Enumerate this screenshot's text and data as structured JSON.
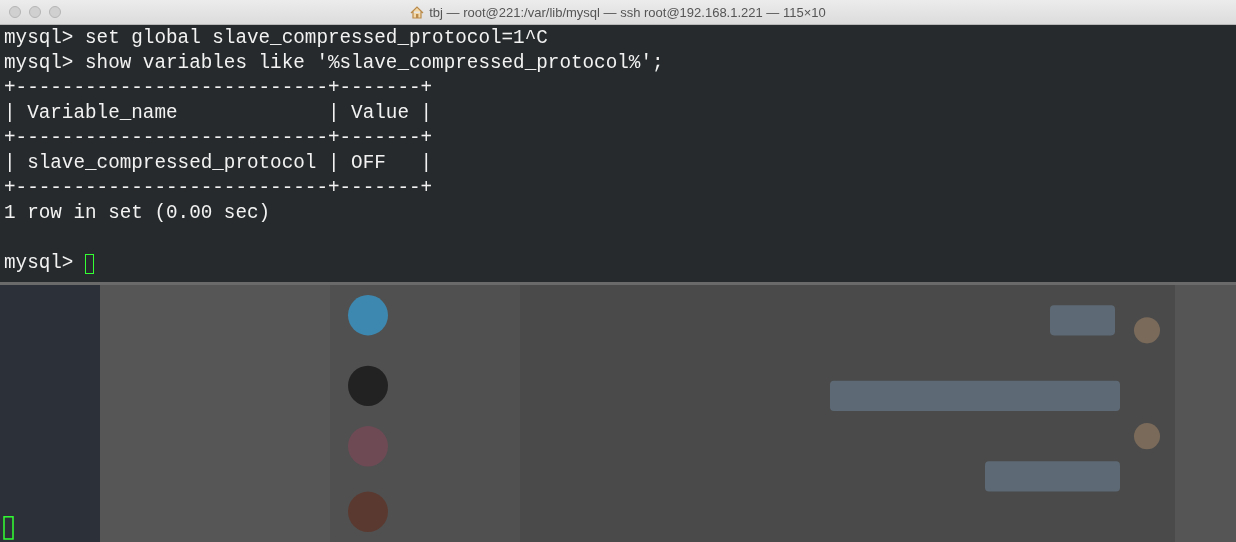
{
  "window": {
    "title": "tbj — root@221:/var/lib/mysql — ssh root@192.168.1.221 — 115×10"
  },
  "terminal": {
    "lines": [
      "mysql> set global slave_compressed_protocol=1^C",
      "mysql> show variables like '%slave_compressed_protocol%';",
      "+---------------------------+-------+",
      "| Variable_name             | Value |",
      "+---------------------------+-------+",
      "| slave_compressed_protocol | OFF   |",
      "+---------------------------+-------+",
      "1 row in set (0.00 sec)"
    ],
    "prompt": "mysql>"
  }
}
